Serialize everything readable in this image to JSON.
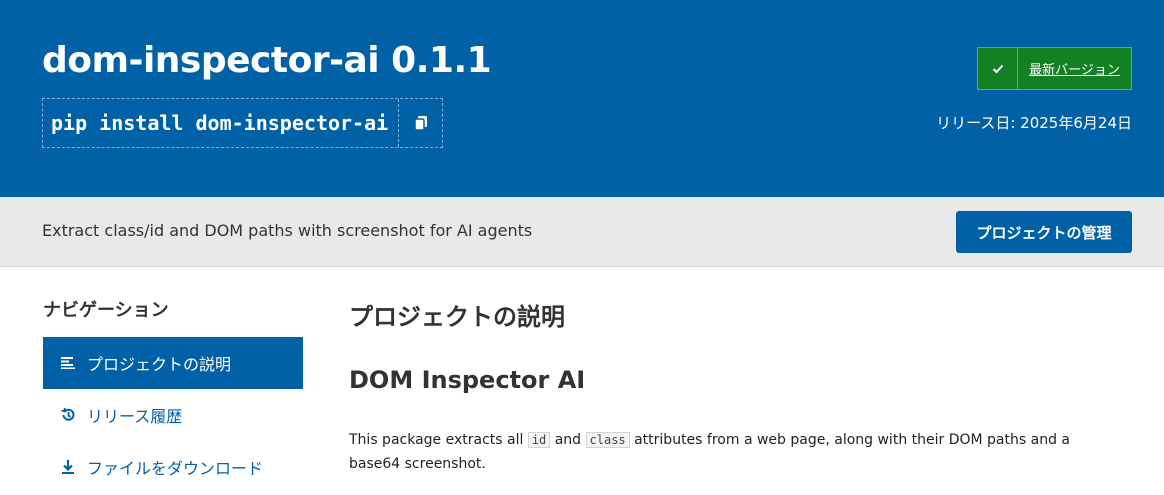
{
  "header": {
    "title": "dom-inspector-ai 0.1.1",
    "pip_command": "pip install dom-inspector-ai",
    "latest_badge": "最新バージョン",
    "release_date": "リリース日: 2025年6月24日",
    "colors": {
      "brand": "#0061a6",
      "badge": "#148024"
    }
  },
  "summary": {
    "text": "Extract class/id and DOM paths with screenshot for AI agents",
    "manage_button": "プロジェクトの管理"
  },
  "nav": {
    "heading": "ナビゲーション",
    "items": [
      {
        "label": "プロジェクトの説明",
        "icon": "align-left-icon",
        "active": true
      },
      {
        "label": "リリース履歴",
        "icon": "history-icon",
        "active": false
      },
      {
        "label": "ファイルをダウンロード",
        "icon": "download-icon",
        "active": false
      }
    ]
  },
  "main": {
    "heading": "プロジェクトの説明",
    "subheading": "DOM Inspector AI",
    "paragraph": {
      "part1": "This package extracts all ",
      "code1": "id",
      "part2": " and ",
      "code2": "class",
      "part3": " attributes from a web page, along with their DOM paths and a base64 screenshot."
    }
  }
}
